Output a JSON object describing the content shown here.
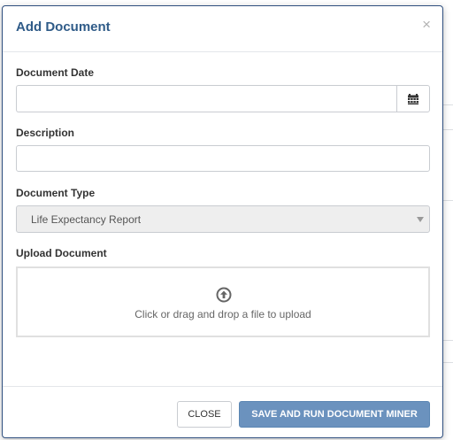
{
  "modal": {
    "title": "Add Document",
    "close_glyph": "×"
  },
  "fields": {
    "document_date": {
      "label": "Document Date",
      "value": "",
      "icon": "calendar-icon"
    },
    "description": {
      "label": "Description",
      "value": ""
    },
    "document_type": {
      "label": "Document Type",
      "selected": "Life Expectancy Report"
    },
    "upload": {
      "label": "Upload Document",
      "icon": "upload-arrow-icon",
      "hint": "Click or drag and drop a file to upload"
    }
  },
  "footer": {
    "close_label": "CLOSE",
    "save_label": "SAVE AND RUN DOCUMENT MINER"
  },
  "colors": {
    "title": "#2f5b88",
    "primary_button": "#6b92be",
    "modal_border": "#2f4f7f"
  }
}
